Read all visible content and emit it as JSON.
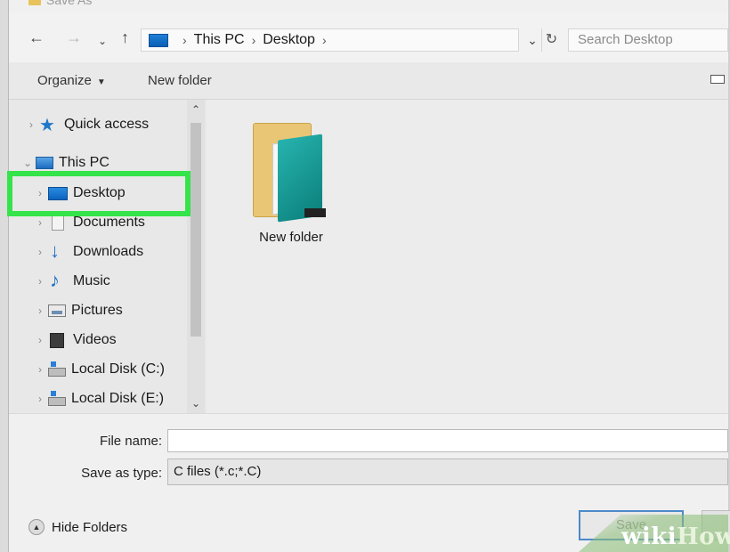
{
  "window": {
    "title": "Save As"
  },
  "address_bar": {
    "crumbs": [
      "This PC",
      "Desktop"
    ],
    "search_placeholder": "Search Desktop"
  },
  "toolbar": {
    "organize_label": "Organize",
    "new_folder_label": "New folder"
  },
  "nav_tree": [
    {
      "label": "Quick access",
      "icon": "star-icon",
      "expanded": false
    },
    {
      "label": "This PC",
      "icon": "computer-icon",
      "expanded": true
    },
    {
      "label": "Desktop",
      "icon": "desktop-icon",
      "selected": true
    },
    {
      "label": "Documents",
      "icon": "documents-icon"
    },
    {
      "label": "Downloads",
      "icon": "downloads-icon"
    },
    {
      "label": "Music",
      "icon": "music-icon"
    },
    {
      "label": "Pictures",
      "icon": "pictures-icon"
    },
    {
      "label": "Videos",
      "icon": "videos-icon"
    },
    {
      "label": "Local Disk (C:)",
      "icon": "disk-icon"
    },
    {
      "label": "Local Disk (E:)",
      "icon": "disk-icon"
    }
  ],
  "content": {
    "items": [
      {
        "label": "New folder",
        "icon": "folder-icon"
      }
    ]
  },
  "form": {
    "file_name_label": "File name:",
    "file_name_value": "",
    "save_type_label": "Save as type:",
    "save_type_value": "C files (*.c;*.C)"
  },
  "footer": {
    "hide_folders_label": "Hide Folders",
    "save_label": "Save"
  },
  "watermark": {
    "part1": "wiki",
    "part2": "How"
  },
  "colors": {
    "highlight": "#35e34a",
    "accent": "#1f78c8",
    "folder_teal": "#1a9e99"
  }
}
